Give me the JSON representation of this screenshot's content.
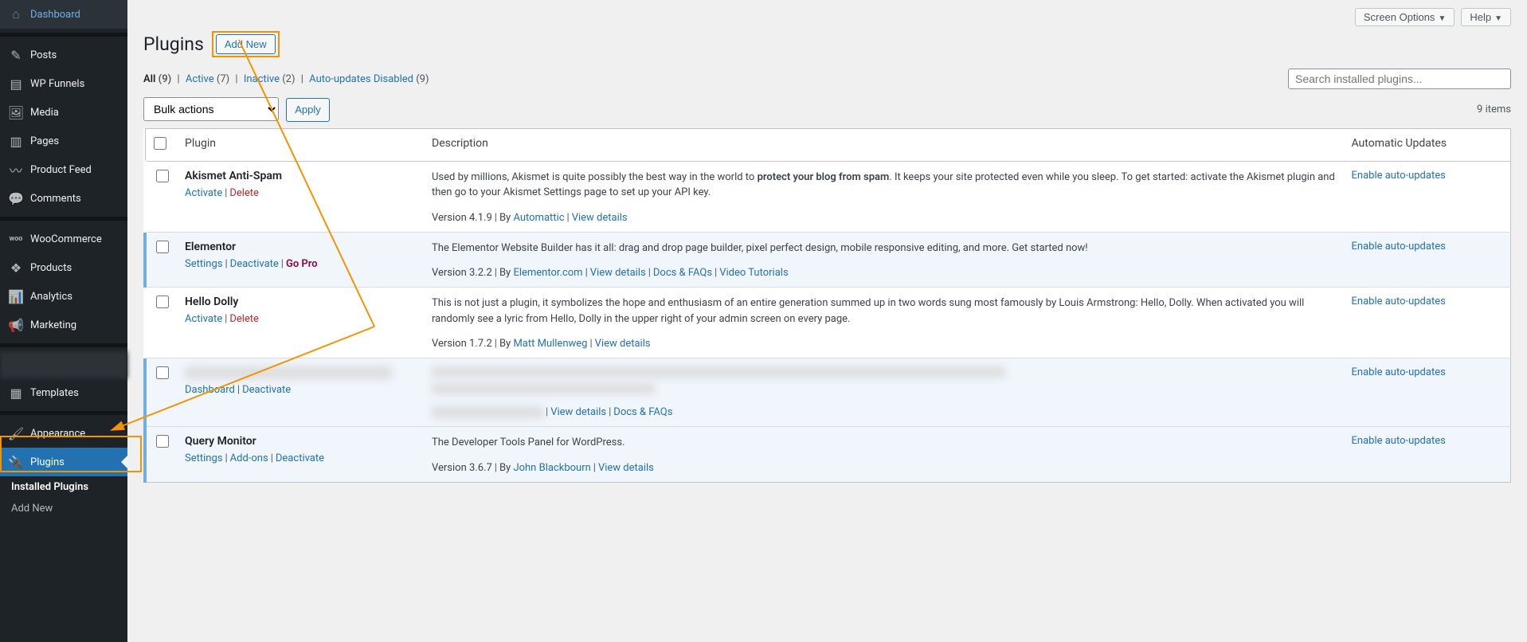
{
  "sidebar": {
    "items": [
      {
        "label": "Dashboard",
        "icon": "⌂"
      },
      {
        "label": "Posts",
        "icon": "✎"
      },
      {
        "label": "WP Funnels",
        "icon": "▤"
      },
      {
        "label": "Media",
        "icon": "🖼"
      },
      {
        "label": "Pages",
        "icon": "▥"
      },
      {
        "label": "Product Feed",
        "icon": "〰"
      },
      {
        "label": "Comments",
        "icon": "💬"
      },
      {
        "label": "WooCommerce",
        "icon": "woo"
      },
      {
        "label": "Products",
        "icon": "❖"
      },
      {
        "label": "Analytics",
        "icon": "📊"
      },
      {
        "label": "Marketing",
        "icon": "📢"
      },
      {
        "label": "Templates",
        "icon": "▦"
      },
      {
        "label": "Appearance",
        "icon": "🖌"
      },
      {
        "label": "Plugins",
        "icon": "🔌"
      }
    ],
    "submenu": [
      {
        "label": "Installed Plugins",
        "current": true
      },
      {
        "label": "Add New",
        "current": false
      }
    ]
  },
  "topbar": {
    "screen_options": "Screen Options",
    "help": "Help"
  },
  "page": {
    "title": "Plugins",
    "add_new": "Add New"
  },
  "filters": {
    "all": {
      "label": "All",
      "count": "(9)"
    },
    "active": {
      "label": "Active",
      "count": "(7)"
    },
    "inactive": {
      "label": "Inactive",
      "count": "(2)"
    },
    "auto_disabled": {
      "label": "Auto-updates Disabled",
      "count": "(9)"
    }
  },
  "search": {
    "placeholder": "Search installed plugins..."
  },
  "bulk": {
    "label": "Bulk actions",
    "apply": "Apply"
  },
  "items_count": "9 items",
  "columns": {
    "plugin": "Plugin",
    "description": "Description",
    "auto": "Automatic Updates"
  },
  "rows": [
    {
      "active": false,
      "name": "Akismet Anti-Spam",
      "actions": [
        {
          "label": "Activate",
          "cls": ""
        },
        {
          "label": "Delete",
          "cls": "del"
        }
      ],
      "desc_pre": "Used by millions, Akismet is quite possibly the best way in the world to ",
      "desc_bold": "protect your blog from spam",
      "desc_post": ". It keeps your site protected even while you sleep. To get started: activate the Akismet plugin and then go to your Akismet Settings page to set up your API key.",
      "version": "Version 4.1.9",
      "by": "By ",
      "author": "Automattic",
      "meta_links": [
        "View details"
      ],
      "auto": "Enable auto-updates"
    },
    {
      "active": true,
      "name": "Elementor",
      "actions": [
        {
          "label": "Settings",
          "cls": ""
        },
        {
          "label": "Deactivate",
          "cls": ""
        },
        {
          "label": "Go Pro",
          "cls": "gopro"
        }
      ],
      "desc_pre": "The Elementor Website Builder has it all: drag and drop page builder, pixel perfect design, mobile responsive editing, and more. Get started now!",
      "desc_bold": "",
      "desc_post": "",
      "version": "Version 3.2.2",
      "by": "By ",
      "author": "Elementor.com",
      "meta_links": [
        "View details",
        "Docs & FAQs",
        "Video Tutorials"
      ],
      "auto": "Enable auto-updates"
    },
    {
      "active": false,
      "name": "Hello Dolly",
      "actions": [
        {
          "label": "Activate",
          "cls": ""
        },
        {
          "label": "Delete",
          "cls": "del"
        }
      ],
      "desc_pre": "This is not just a plugin, it symbolizes the hope and enthusiasm of an entire generation summed up in two words sung most famously by Louis Armstrong: Hello, Dolly. When activated you will randomly see a lyric from Hello, Dolly in the upper right of your admin screen on every page.",
      "desc_bold": "",
      "desc_post": "",
      "version": "Version 1.7.2",
      "by": "By ",
      "author": "Matt Mullenweg",
      "meta_links": [
        "View details"
      ],
      "auto": "Enable auto-updates"
    },
    {
      "active": true,
      "blurred": true,
      "name": "████████████████",
      "actions": [
        {
          "label": "Dashboard",
          "cls": ""
        },
        {
          "label": "Deactivate",
          "cls": ""
        }
      ],
      "desc_pre": "",
      "desc_bold": "",
      "desc_post": "",
      "version": "",
      "by": "",
      "author": "",
      "meta_links": [
        "View details",
        "Docs & FAQs"
      ],
      "auto": "Enable auto-updates"
    },
    {
      "active": true,
      "name": "Query Monitor",
      "actions": [
        {
          "label": "Settings",
          "cls": ""
        },
        {
          "label": "Add-ons",
          "cls": ""
        },
        {
          "label": "Deactivate",
          "cls": ""
        }
      ],
      "desc_pre": "The Developer Tools Panel for WordPress.",
      "desc_bold": "",
      "desc_post": "",
      "version": "Version 3.6.7",
      "by": "By ",
      "author": "John Blackbourn",
      "meta_links": [
        "View details"
      ],
      "auto": "Enable auto-updates"
    }
  ]
}
